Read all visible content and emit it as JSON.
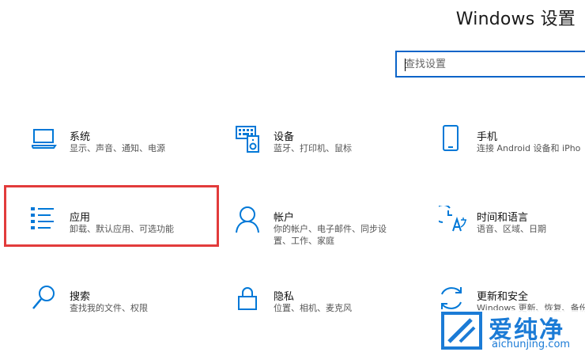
{
  "window": {
    "title": "Windows 设置"
  },
  "search": {
    "placeholder": "查找设置"
  },
  "tiles": [
    {
      "name": "系统",
      "desc": "显示、声音、通知、电源",
      "icon": "laptop-icon"
    },
    {
      "name": "设备",
      "desc": "蓝牙、打印机、鼠标",
      "icon": "devices-icon"
    },
    {
      "name": "手机",
      "desc": "连接 Android 设备和 iPho",
      "icon": "phone-icon"
    },
    {
      "name": "应用",
      "desc": "卸载、默认应用、可选功能",
      "icon": "apps-list-icon"
    },
    {
      "name": "帐户",
      "desc_line1": "你的帐户、电子邮件、同步设",
      "desc_line2": "置、工作、家庭",
      "icon": "person-icon"
    },
    {
      "name": "时间和语言",
      "desc": "语音、区域、日期",
      "icon": "time-language-icon"
    },
    {
      "name": "搜索",
      "desc": "查找我的文件、权限",
      "icon": "search-icon"
    },
    {
      "name": "隐私",
      "desc": "位置、相机、麦克风",
      "icon": "lock-icon"
    },
    {
      "name": "更新和安全",
      "desc": "Windows 更新、恢复、备份",
      "icon": "update-icon"
    }
  ],
  "watermark": {
    "cn": "爱纯净",
    "en": "aichunjing.com"
  },
  "colors": {
    "accent": "#0078d7",
    "search_border": "#0a64c8",
    "highlight_border": "#e23b3b",
    "watermark": "#1b7bd6"
  }
}
